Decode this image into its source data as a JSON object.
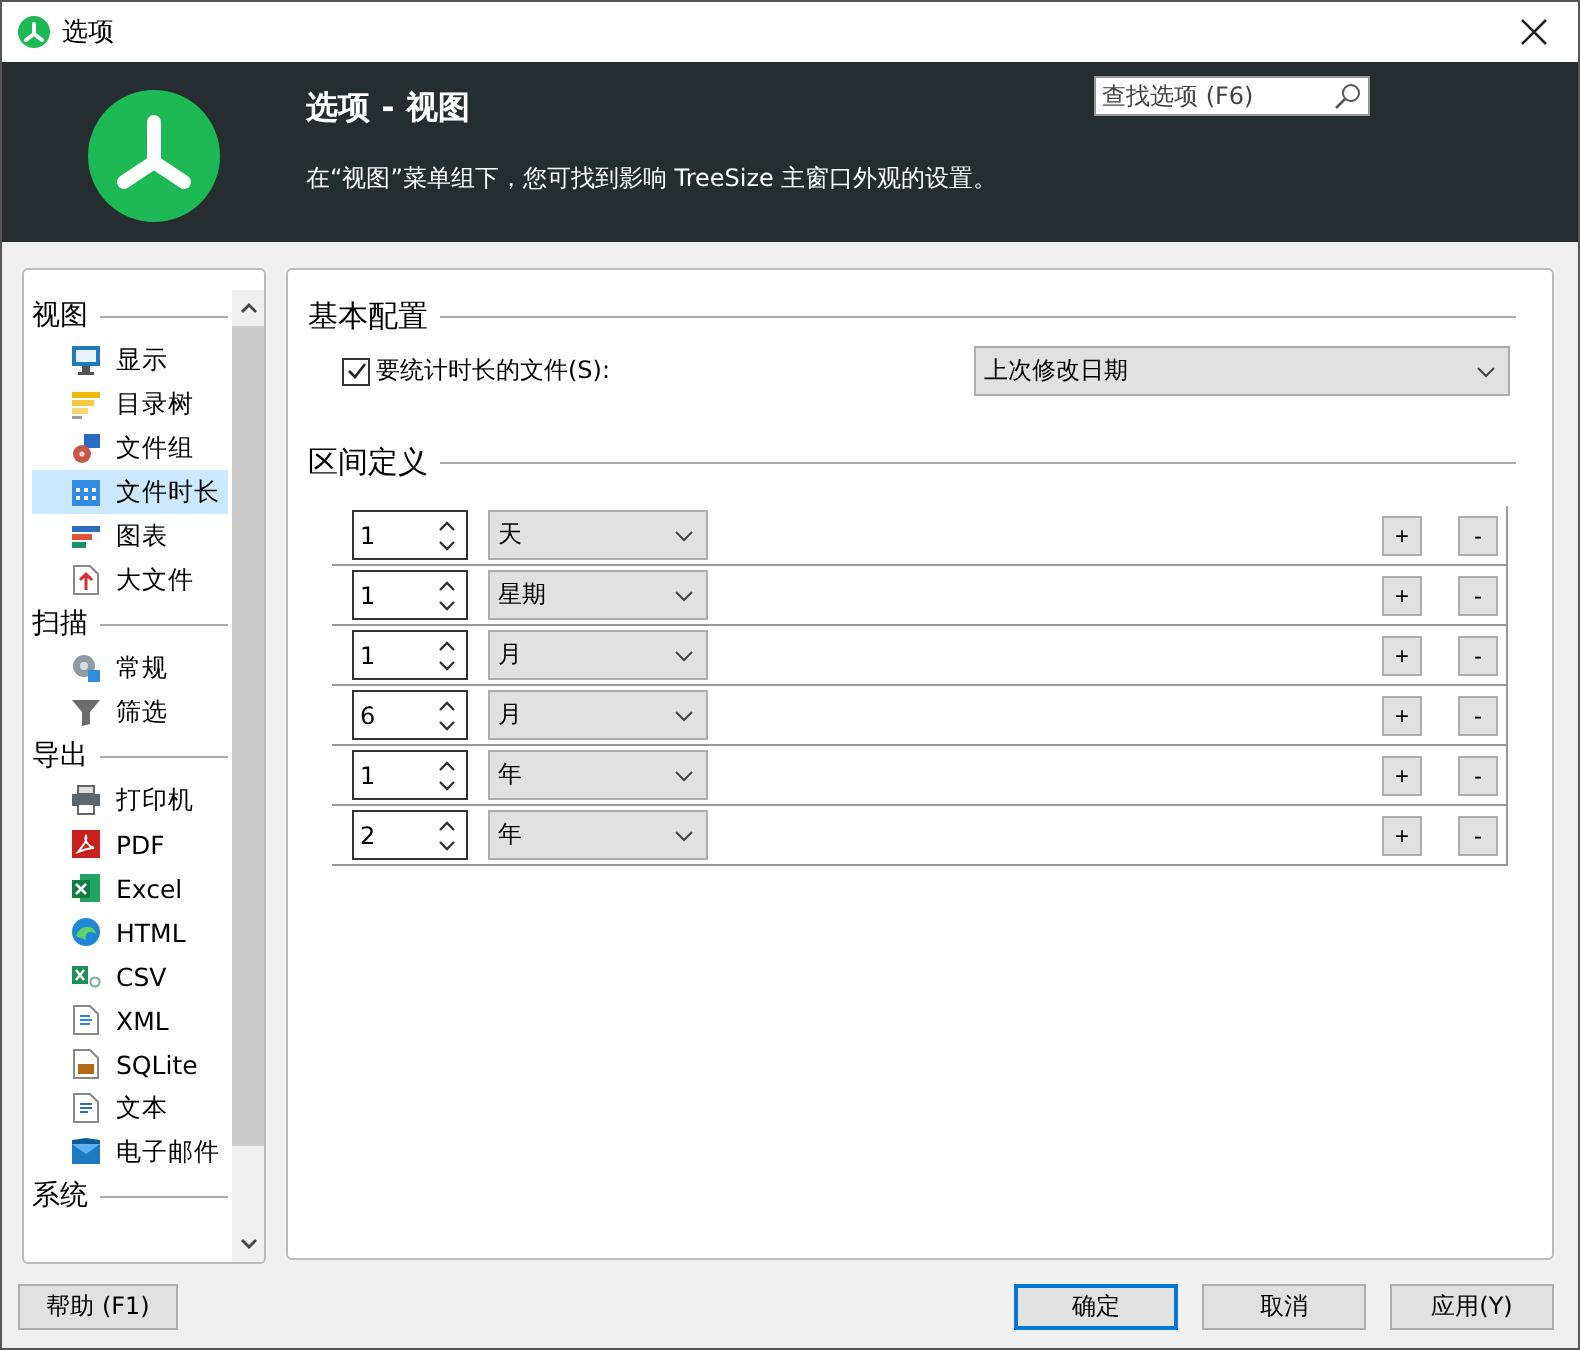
{
  "window": {
    "title": "选项"
  },
  "header": {
    "title": "选项 - 视图",
    "description": "在“视图”菜单组下，您可找到影响 TreeSize 主窗口外观的设置。",
    "search": {
      "placeholder": "查找选项 (F6)"
    }
  },
  "sidebar": {
    "groups": [
      {
        "label": "视图",
        "items": [
          {
            "label": "显示",
            "selected": false
          },
          {
            "label": "目录树",
            "selected": false
          },
          {
            "label": "文件组",
            "selected": false
          },
          {
            "label": "文件时长",
            "selected": true
          },
          {
            "label": "图表",
            "selected": false
          },
          {
            "label": "大文件",
            "selected": false
          }
        ]
      },
      {
        "label": "扫描",
        "items": [
          {
            "label": "常规",
            "selected": false
          },
          {
            "label": "筛选",
            "selected": false
          }
        ]
      },
      {
        "label": "导出",
        "items": [
          {
            "label": "打印机",
            "selected": false
          },
          {
            "label": "PDF",
            "selected": false
          },
          {
            "label": "Excel",
            "selected": false
          },
          {
            "label": "HTML",
            "selected": false
          },
          {
            "label": "CSV",
            "selected": false
          },
          {
            "label": "XML",
            "selected": false
          },
          {
            "label": "SQLite",
            "selected": false
          },
          {
            "label": "文本",
            "selected": false
          },
          {
            "label": "电子邮件",
            "selected": false
          }
        ]
      },
      {
        "label": "系统"
      }
    ]
  },
  "basic": {
    "heading": "基本配置",
    "checkbox": {
      "label": "要统计时长的文件(S):",
      "checked": true
    },
    "dropdown": {
      "value": "上次修改日期"
    }
  },
  "intervals": {
    "heading": "区间定义",
    "rows": [
      {
        "amount": "1",
        "unit": "天",
        "add": "+",
        "remove": "-"
      },
      {
        "amount": "1",
        "unit": "星期",
        "add": "+",
        "remove": "-"
      },
      {
        "amount": "1",
        "unit": "月",
        "add": "+",
        "remove": "-"
      },
      {
        "amount": "6",
        "unit": "月",
        "add": "+",
        "remove": "-"
      },
      {
        "amount": "1",
        "unit": "年",
        "add": "+",
        "remove": "-"
      },
      {
        "amount": "2",
        "unit": "年",
        "add": "+",
        "remove": "-"
      }
    ]
  },
  "buttons": {
    "help": "帮助 (F1)",
    "ok": "确定",
    "cancel": "取消",
    "apply": "应用(Y)"
  }
}
